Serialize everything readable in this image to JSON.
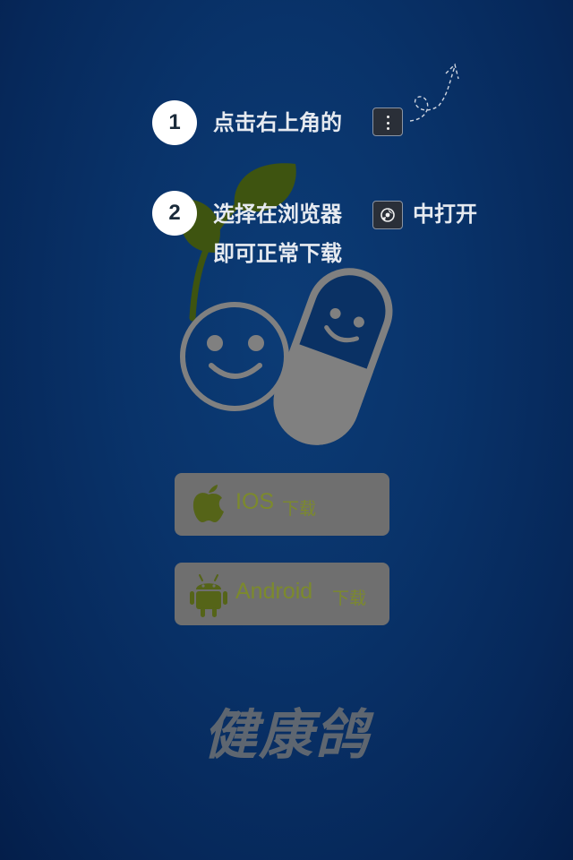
{
  "steps": [
    {
      "number": "1",
      "text": "点击右上角的"
    },
    {
      "number": "2",
      "text_line1": "选择在浏览器",
      "text_suffix": "中打开",
      "text_line2": "即可正常下载"
    }
  ],
  "icons": {
    "menu": "vertical-dots-menu-icon",
    "browser": "browser-globe-icon",
    "arrow": "dashed-curved-arrow-icon",
    "apple": "apple-icon",
    "android": "android-icon"
  },
  "buttons": {
    "ios": {
      "main": "IOS",
      "sub": "下载"
    },
    "android": {
      "main": "Android",
      "sub": "下载"
    }
  },
  "brand": {
    "name": "健康鸽"
  },
  "colors": {
    "background": "#06285a",
    "button_bg": "#6f6f6f",
    "button_text": "#7c8a2c",
    "leaf": "#3e5410",
    "illustration_gray": "#808080"
  }
}
